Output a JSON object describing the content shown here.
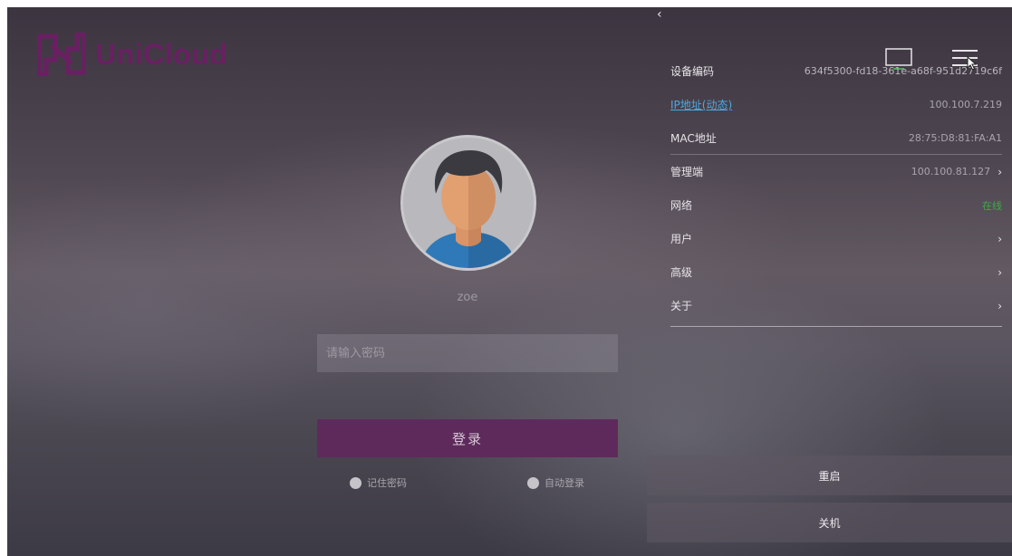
{
  "logo": {
    "text": "UniCloud"
  },
  "login": {
    "username": "zoe",
    "password_placeholder": "请输入密码",
    "login_label": "登录",
    "remember_label": "记住密码",
    "autologin_label": "自动登录"
  },
  "panel": {
    "back_glyph": "‹",
    "rows": [
      {
        "label": "设备编码",
        "value": "634f5300-fd18-361e-a68f-951d2719c6f"
      },
      {
        "label": "IP地址(动态)",
        "value": "100.100.7.219"
      },
      {
        "label": "MAC地址",
        "value": "28:75:D8:81:FA:A1"
      },
      {
        "label": "管理端",
        "value": "100.100.81.127",
        "chevron": "›"
      },
      {
        "label": "网络",
        "value": "在线"
      },
      {
        "label": "用户",
        "value": "",
        "chevron": "›"
      },
      {
        "label": "高级",
        "value": "",
        "chevron": "›"
      },
      {
        "label": "关于",
        "value": "",
        "chevron": "›"
      }
    ],
    "restart_label": "重启",
    "shutdown_label": "关机"
  },
  "colors": {
    "brand": "#6a1f63",
    "login_button": "#5e2a5c",
    "link": "#4fa8e0",
    "online": "#3fa94a"
  },
  "icons": [
    "unicloud-logo",
    "avatar-icon",
    "display-icon",
    "menu-icon",
    "chevron-right-icon",
    "chevron-left-icon",
    "cursor-icon"
  ]
}
